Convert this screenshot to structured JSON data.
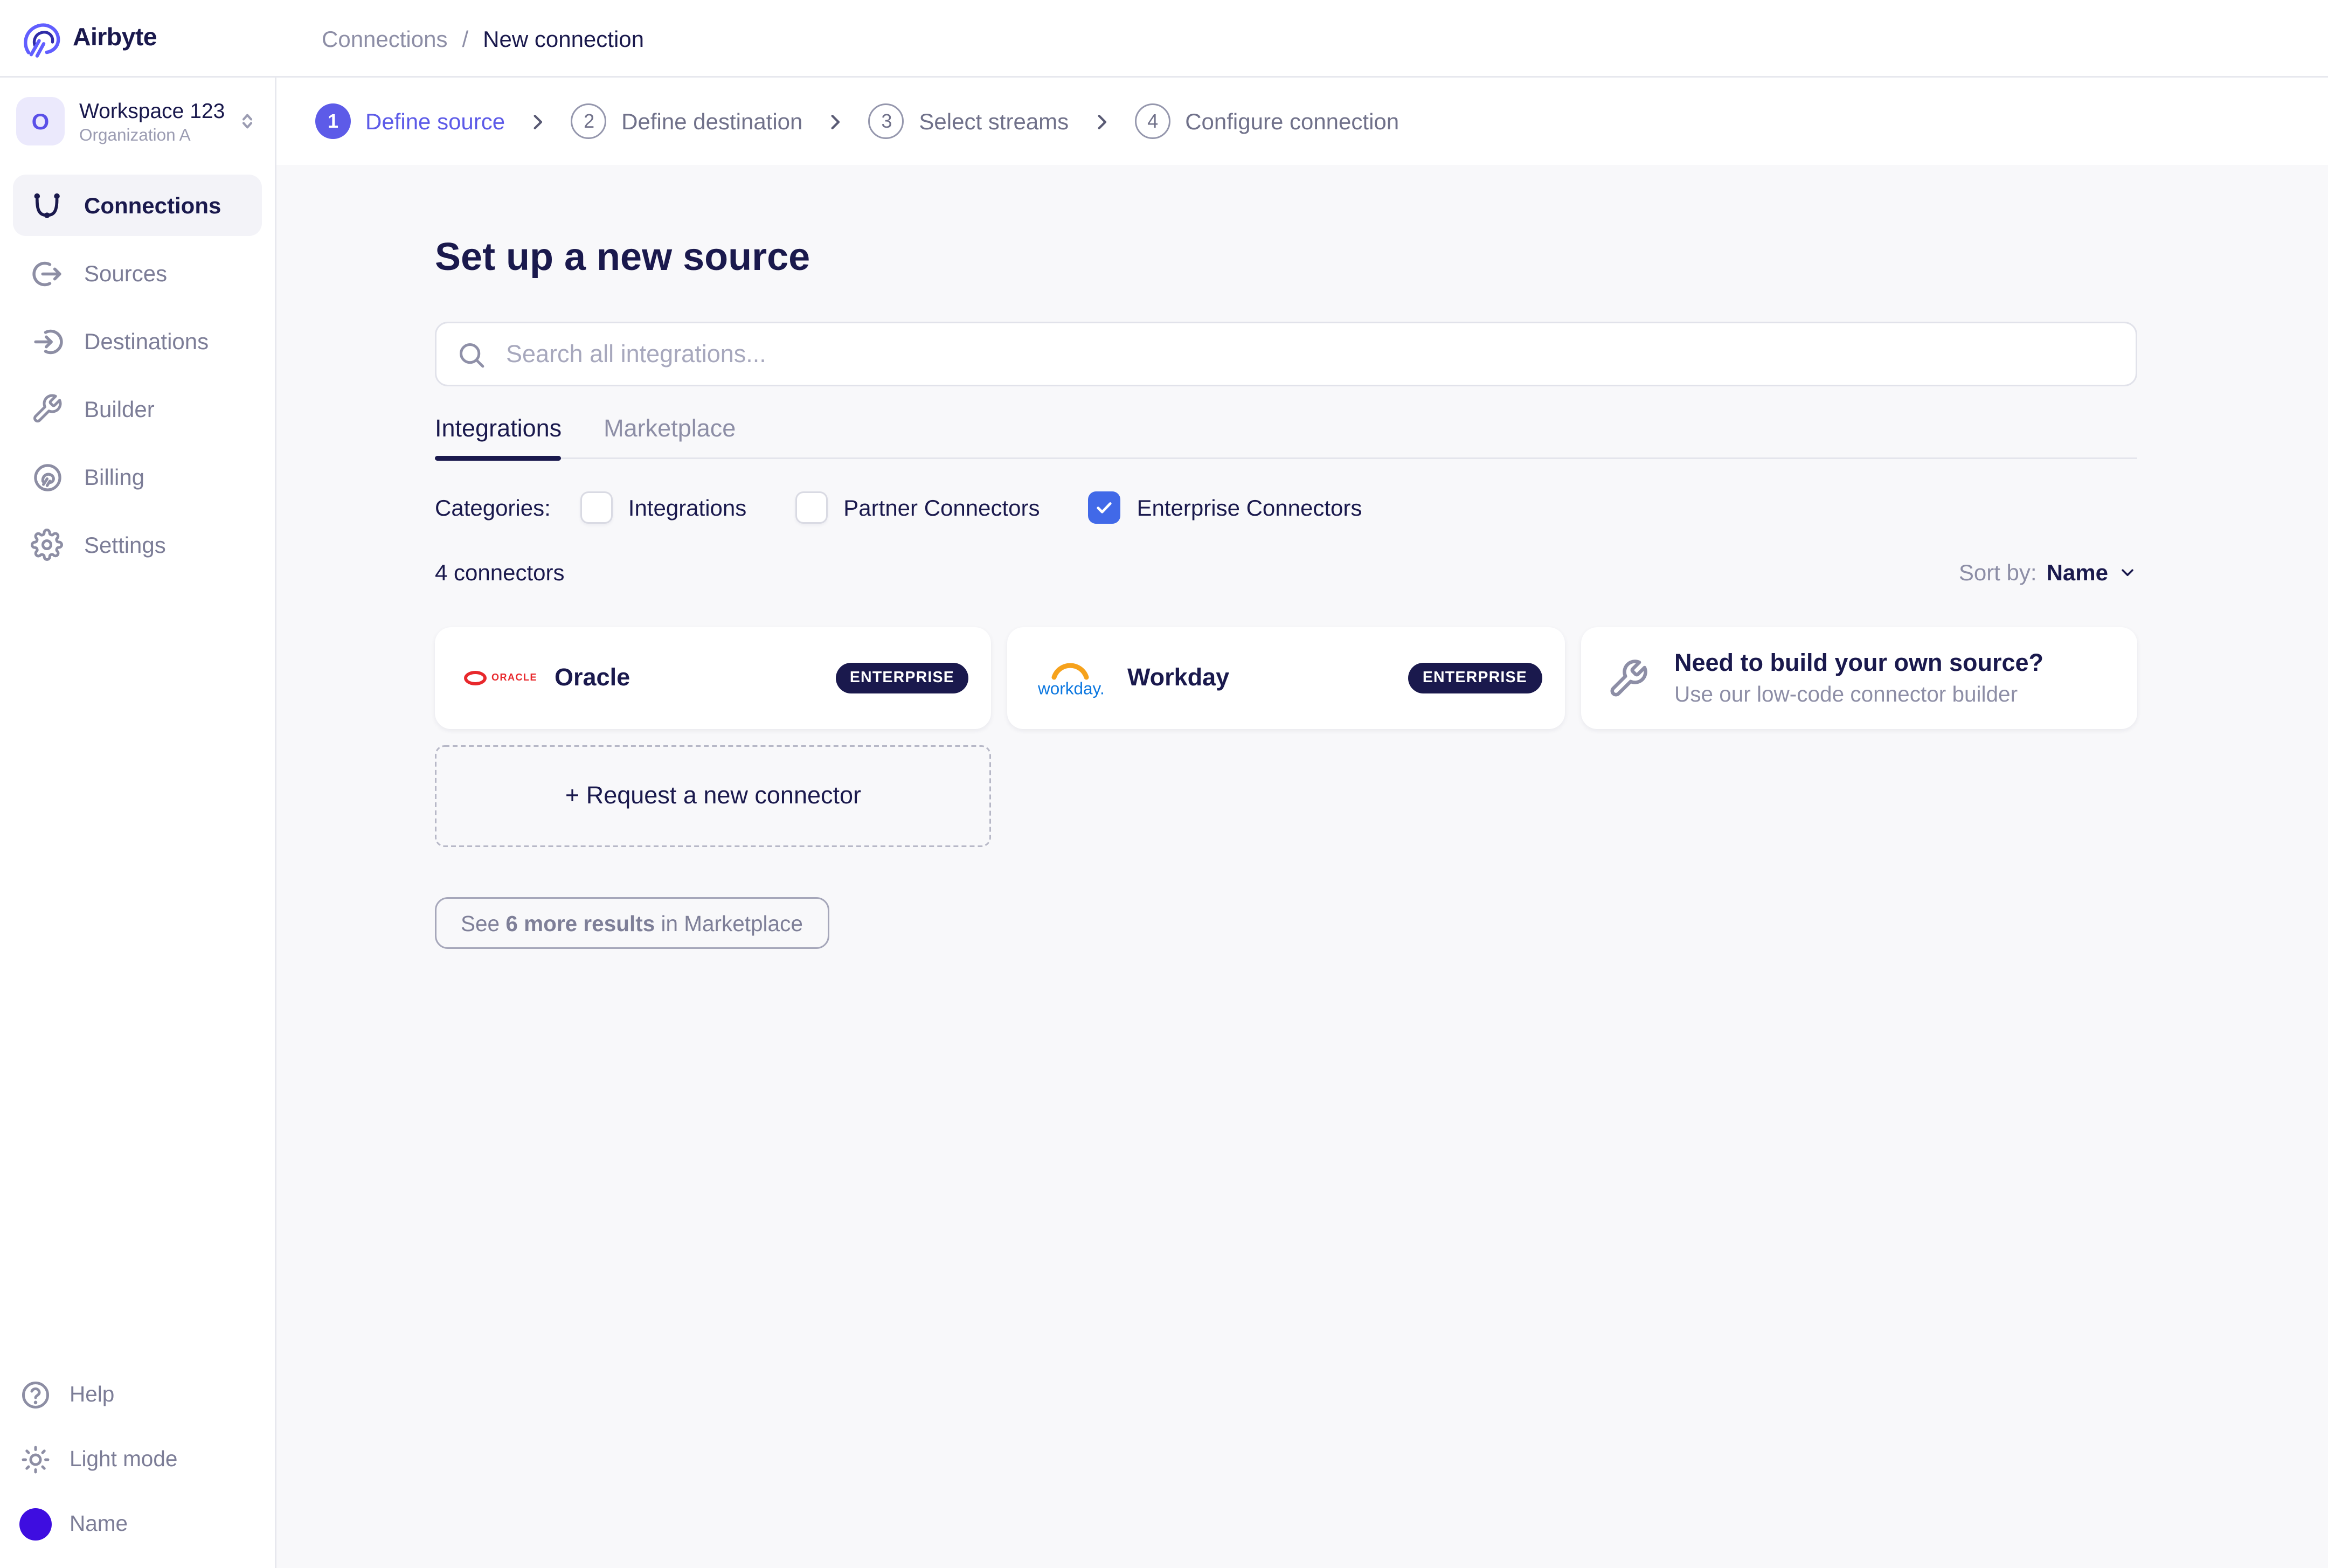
{
  "brand": {
    "name": "Airbyte"
  },
  "workspace": {
    "avatar_letter": "O",
    "name": "Workspace 123",
    "org": "Organization A"
  },
  "sidebar": {
    "items": [
      {
        "label": "Connections",
        "active": true
      },
      {
        "label": "Sources",
        "active": false
      },
      {
        "label": "Destinations",
        "active": false
      },
      {
        "label": "Builder",
        "active": false
      },
      {
        "label": "Billing",
        "active": false
      },
      {
        "label": "Settings",
        "active": false
      }
    ],
    "footer": {
      "help": "Help",
      "theme": "Light mode",
      "user": "Name"
    }
  },
  "breadcrumb": {
    "parent": "Connections",
    "separator": "/",
    "current": "New connection"
  },
  "stepper": {
    "steps": [
      {
        "num": "1",
        "label": "Define source",
        "active": true
      },
      {
        "num": "2",
        "label": "Define destination",
        "active": false
      },
      {
        "num": "3",
        "label": "Select streams",
        "active": false
      },
      {
        "num": "4",
        "label": "Configure connection",
        "active": false
      }
    ]
  },
  "main": {
    "title": "Set up a new source",
    "search_placeholder": "Search all integrations...",
    "tabs": [
      {
        "label": "Integrations",
        "active": true
      },
      {
        "label": "Marketplace",
        "active": false
      }
    ],
    "categories": {
      "label": "Categories:",
      "options": [
        {
          "label": "Integrations",
          "checked": false
        },
        {
          "label": "Partner Connectors",
          "checked": false
        },
        {
          "label": "Enterprise Connectors",
          "checked": true
        }
      ]
    },
    "results_count": "4 connectors",
    "sort": {
      "label": "Sort by:",
      "value": "Name"
    },
    "connectors": [
      {
        "name": "Oracle",
        "badge": "ENTERPRISE",
        "logo_text": "ORACLE"
      },
      {
        "name": "Workday",
        "badge": "ENTERPRISE",
        "logo_text": "workday."
      }
    ],
    "build_card": {
      "title": "Need to build your own source?",
      "subtitle": "Use our low-code connector builder"
    },
    "request_button": "+ Request a new connector",
    "see_more": {
      "prefix": "See ",
      "bold": "6 more results",
      "suffix": " in Marketplace"
    }
  },
  "colors": {
    "accent_indigo": "#5D5BE8",
    "dark_navy": "#1A194D",
    "checkbox_checked": "#4169E8",
    "badge_bg": "#1A194D",
    "oracle_red": "#E8282C",
    "workday_blue": "#0B77E0",
    "workday_orange": "#F6A21C",
    "user_avatar": "#3E0DE0",
    "content_bg": "#F8F8FA"
  }
}
